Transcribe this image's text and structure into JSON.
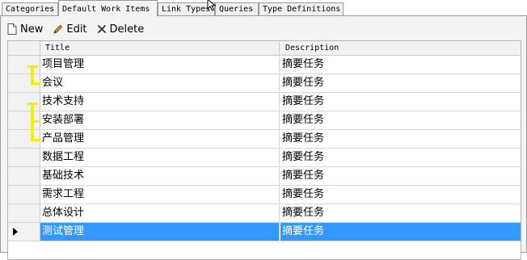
{
  "tabs": [
    {
      "label": "Categories",
      "active": false
    },
    {
      "label": "Default Work Items",
      "active": true
    },
    {
      "label": "Link Types",
      "active": false
    },
    {
      "label": "Queries",
      "active": false
    },
    {
      "label": "Type Definitions",
      "active": false
    }
  ],
  "toolbar": {
    "new_label": "New",
    "edit_label": "Edit",
    "delete_label": "Delete"
  },
  "grid": {
    "columns": [
      "Title",
      "Description"
    ],
    "rows": [
      {
        "title": "项目管理",
        "description": "摘要任务"
      },
      {
        "title": "会议",
        "description": "摘要任务"
      },
      {
        "title": "技术支持",
        "description": "摘要任务"
      },
      {
        "title": "安装部署",
        "description": "摘要任务"
      },
      {
        "title": "产品管理",
        "description": "摘要任务"
      },
      {
        "title": "数据工程",
        "description": "摘要任务"
      },
      {
        "title": "基础技术",
        "description": "摘要任务"
      },
      {
        "title": "需求工程",
        "description": "摘要任务"
      },
      {
        "title": "总体设计",
        "description": "摘要任务"
      },
      {
        "title": "测试管理",
        "description": "摘要任务"
      }
    ],
    "selected_index": 9
  },
  "colors": {
    "selection": "#3399ff",
    "highlight_marks": "#f6f000"
  }
}
